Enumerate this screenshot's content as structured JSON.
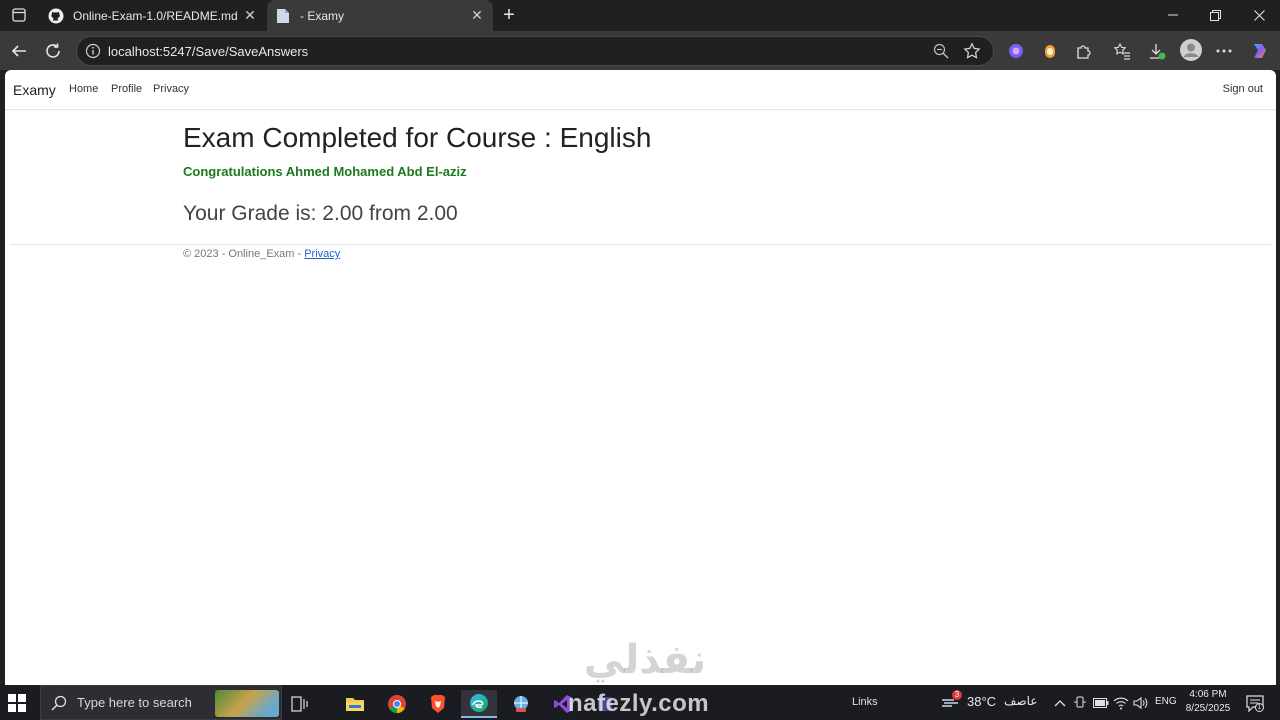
{
  "browser": {
    "tabs": [
      {
        "title": "Online-Exam-1.0/README.md at",
        "active": false
      },
      {
        "title": "- Examy",
        "active": true
      }
    ],
    "url": "localhost:5247/Save/SaveAnswers"
  },
  "page": {
    "navbar": {
      "brand": "Examy",
      "links": [
        "Home",
        "Profile",
        "Privacy"
      ],
      "sign_out": "Sign out"
    },
    "heading": "Exam Completed for Course : English",
    "congrats": "Congratulations Ahmed Mohamed Abd El-aziz",
    "grade": "Your Grade is: 2.00 from 2.00",
    "footer": {
      "text": "© 2023 - Online_Exam - ",
      "link": "Privacy"
    },
    "watermark": {
      "arabic": "نفذلي",
      "latin": "nafezly.com"
    }
  },
  "taskbar": {
    "search_placeholder": "Type here to search",
    "links_label": "Links",
    "weather": {
      "temp": "38°C",
      "condition": "عاصف",
      "alert_count": "3"
    },
    "language": "ENG",
    "time": "4:06 PM",
    "date": "8/25/2025",
    "notification_count": "1"
  },
  "colors": {
    "success_green": "#1b7a1b",
    "link_blue": "#2363d1"
  }
}
